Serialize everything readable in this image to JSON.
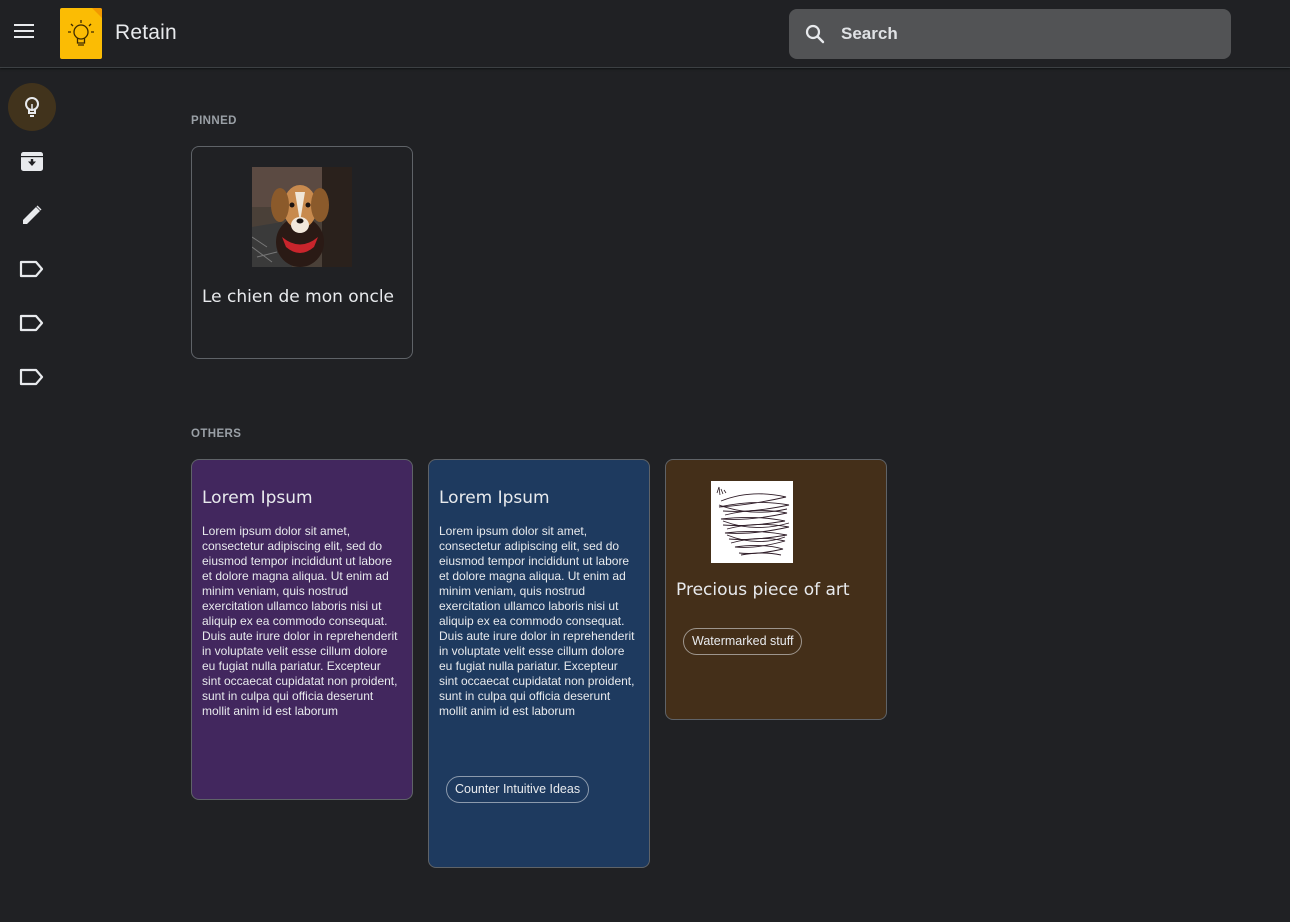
{
  "app": {
    "title": "Retain",
    "search_placeholder": "Search"
  },
  "sidebar": {
    "items": [
      {
        "name": "notes",
        "icon": "lightbulb-icon",
        "active": true
      },
      {
        "name": "archive",
        "icon": "archive-icon",
        "active": false
      },
      {
        "name": "edit-labels",
        "icon": "pencil-icon",
        "active": false
      },
      {
        "name": "label-1",
        "icon": "label-icon",
        "active": false
      },
      {
        "name": "label-2",
        "icon": "label-icon",
        "active": false
      },
      {
        "name": "label-3",
        "icon": "label-icon",
        "active": false
      }
    ]
  },
  "sections": {
    "pinned_label": "PINNED",
    "others_label": "OTHERS"
  },
  "notes": {
    "pinned": [
      {
        "title": "Le chien de mon oncle",
        "image": "dog-photo"
      }
    ],
    "others": [
      {
        "title": "Lorem Ipsum",
        "body": "Lorem ipsum dolor sit amet, consectetur adipiscing elit, sed do eiusmod tempor incididunt ut labore et dolore magna aliqua. Ut enim ad minim veniam, quis nostrud exercitation ullamco laboris nisi ut aliquip ex ea commodo consequat. Duis aute irure dolor in reprehenderit in voluptate velit esse cillum dolore eu fugiat nulla pariatur. Excepteur sint occaecat cupidatat non proident, sunt in culpa qui officia deserunt mollit anim id est laborum",
        "color": "#42275e"
      },
      {
        "title": "Lorem Ipsum",
        "body": "Lorem ipsum dolor sit amet, consectetur adipiscing elit, sed do eiusmod tempor incididunt ut labore et dolore magna aliqua. Ut enim ad minim veniam, quis nostrud exercitation ullamco laboris nisi ut aliquip ex ea commodo consequat. Duis aute irure dolor in reprehenderit in voluptate velit esse cillum dolore eu fugiat nulla pariatur. Excepteur sint occaecat cupidatat non proident, sunt in culpa qui officia deserunt mollit anim id est laborum",
        "label": "Counter Intuitive Ideas",
        "color": "#1e3a5f"
      },
      {
        "title": "Precious piece of art",
        "image": "scribble-drawing",
        "label": "Watermarked stuff",
        "color": "#442f19"
      }
    ]
  },
  "colors": {
    "background": "#202124",
    "accent": "#fbbc04",
    "search_bg": "#525355"
  }
}
